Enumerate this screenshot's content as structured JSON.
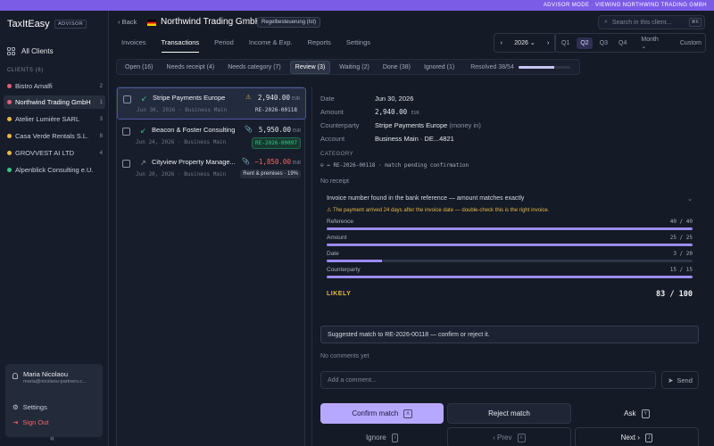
{
  "banner": "ADVISOR MODE · VIEWING NORTHWIND TRADING GMBH",
  "brand": {
    "logo": "TaxItEasy",
    "badge": "ADVISOR"
  },
  "sidebar": {
    "all_clients": "All Clients",
    "clients_header": "CLIENTS (6)",
    "clients": [
      {
        "name": "Bistro Amalfi",
        "count": "2",
        "color": "#e0607a"
      },
      {
        "name": "Northwind Trading GmbH",
        "count": "1",
        "color": "#e0607a"
      },
      {
        "name": "Atelier Lumière SARL",
        "count": "3",
        "color": "#e8b84a"
      },
      {
        "name": "Casa Verde Rentals S.L.",
        "count": "8",
        "color": "#e8b84a"
      },
      {
        "name": "GROVVEST AI LTD",
        "count": "4",
        "color": "#e8b84a"
      },
      {
        "name": "Alpenblick Consulting e.U.",
        "count": "",
        "color": "#3cc38a"
      }
    ],
    "user": {
      "name": "Maria Nicolaou",
      "email": "maria@nicolaou-partners.c...",
      "settings": "Settings",
      "signout": "Sign Out"
    },
    "collapse": "«"
  },
  "header": {
    "back": "Back",
    "client_name": "Northwind Trading GmbH",
    "tax_badge": "Regelbesteuerung (Ist)",
    "search_placeholder": "Search in this client...",
    "search_kbd": "⌘K"
  },
  "tabs": [
    "Invoices",
    "Transactions",
    "Period",
    "Income & Exp.",
    "Reports",
    "Settings"
  ],
  "period": {
    "prev": "‹",
    "year": "2026",
    "next": "›",
    "quarters": [
      "Q1",
      "Q2",
      "Q3",
      "Q4"
    ],
    "active": "Q2",
    "month": "Month",
    "custom": "Custom"
  },
  "filters": {
    "items": [
      "Open (16)",
      "Needs receipt (4)",
      "Needs category (7)",
      "Review (3)",
      "Waiting (2)",
      "Done (38)",
      "Ignored (1)"
    ],
    "active": "Review (3)",
    "resolved": "Resolved 38/54",
    "resolved_fraction": 0.7
  },
  "transactions": [
    {
      "name": "Stripe Payments Europe",
      "amount": "2,940.00",
      "currency": "EUR",
      "date": "Jun 30, 2026",
      "account": "Business Main",
      "badge": "RE-2026-00118",
      "direction": "in",
      "flag": "⚠"
    },
    {
      "name": "Beacon & Foster Consulting",
      "amount": "5,950.00",
      "currency": "EUR",
      "date": "Jun 24, 2026",
      "account": "Business Main",
      "badge": "RE-2026-00097",
      "direction": "in",
      "flag": "📎"
    },
    {
      "name": "Cityview Property Manage...",
      "amount": "−1,850.00",
      "currency": "EUR",
      "date": "Jun 20, 2026",
      "account": "Business Main",
      "badge": "Rent & premises · 19%",
      "direction": "out",
      "flag": "📎"
    }
  ],
  "detail": {
    "date_label": "Date",
    "date": "Jun 30, 2026",
    "amount_label": "Amount",
    "amount": "2,940.00",
    "currency": "EUR",
    "counterparty_label": "Counterparty",
    "counterparty": "Stripe Payments Europe",
    "counterparty_note": "(money in)",
    "account_label": "Account",
    "account": "Business Main · DE...4821",
    "category_label": "CATEGORY",
    "category_value": "⊖ ↔ RE-2026-00118 · match pending confirmation",
    "no_receipt": "No receipt",
    "match_title": "Invoice number found in the bank reference — amount matches exactly",
    "match_warning": "The payment arrived 24 days after the invoice date — double-check this is the right invoice.",
    "criteria": [
      {
        "label": "Reference",
        "score": "40 / 40",
        "fraction": 1.0
      },
      {
        "label": "Amount",
        "score": "25 / 25",
        "fraction": 1.0
      },
      {
        "label": "Date",
        "score": "3 / 20",
        "fraction": 0.15
      },
      {
        "label": "Counterparty",
        "score": "15 / 15",
        "fraction": 1.0
      }
    ],
    "likely": "LIKELY",
    "total": "83 / 100",
    "suggestion": "Suggested match to RE-2026-00118 — confirm or reject it.",
    "no_comments": "No comments yet",
    "comment_placeholder": "Add a comment...",
    "send": "Send",
    "actions": {
      "confirm": "Confirm match",
      "confirm_kbd": "A",
      "reject": "Reject match",
      "ask": "Ask",
      "ask_kbd": "Y",
      "ignore": "Ignore",
      "ignore_kbd": "I",
      "prev": "‹ Prev",
      "prev_kbd": "K",
      "next": "Next ›",
      "next_kbd": "J"
    }
  }
}
